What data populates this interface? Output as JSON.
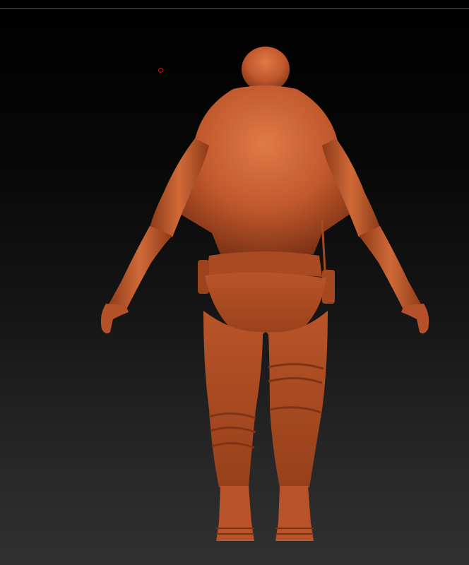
{
  "viewport": {
    "background_top": "#000000",
    "background_bottom": "#303030",
    "divider_color": "#5a5a5a"
  },
  "model": {
    "material_color": "#c0582c",
    "material_shadow": "#7a3115",
    "material_highlight": "#e07a45"
  },
  "icons": {
    "cursor": "brush-cursor-icon"
  }
}
